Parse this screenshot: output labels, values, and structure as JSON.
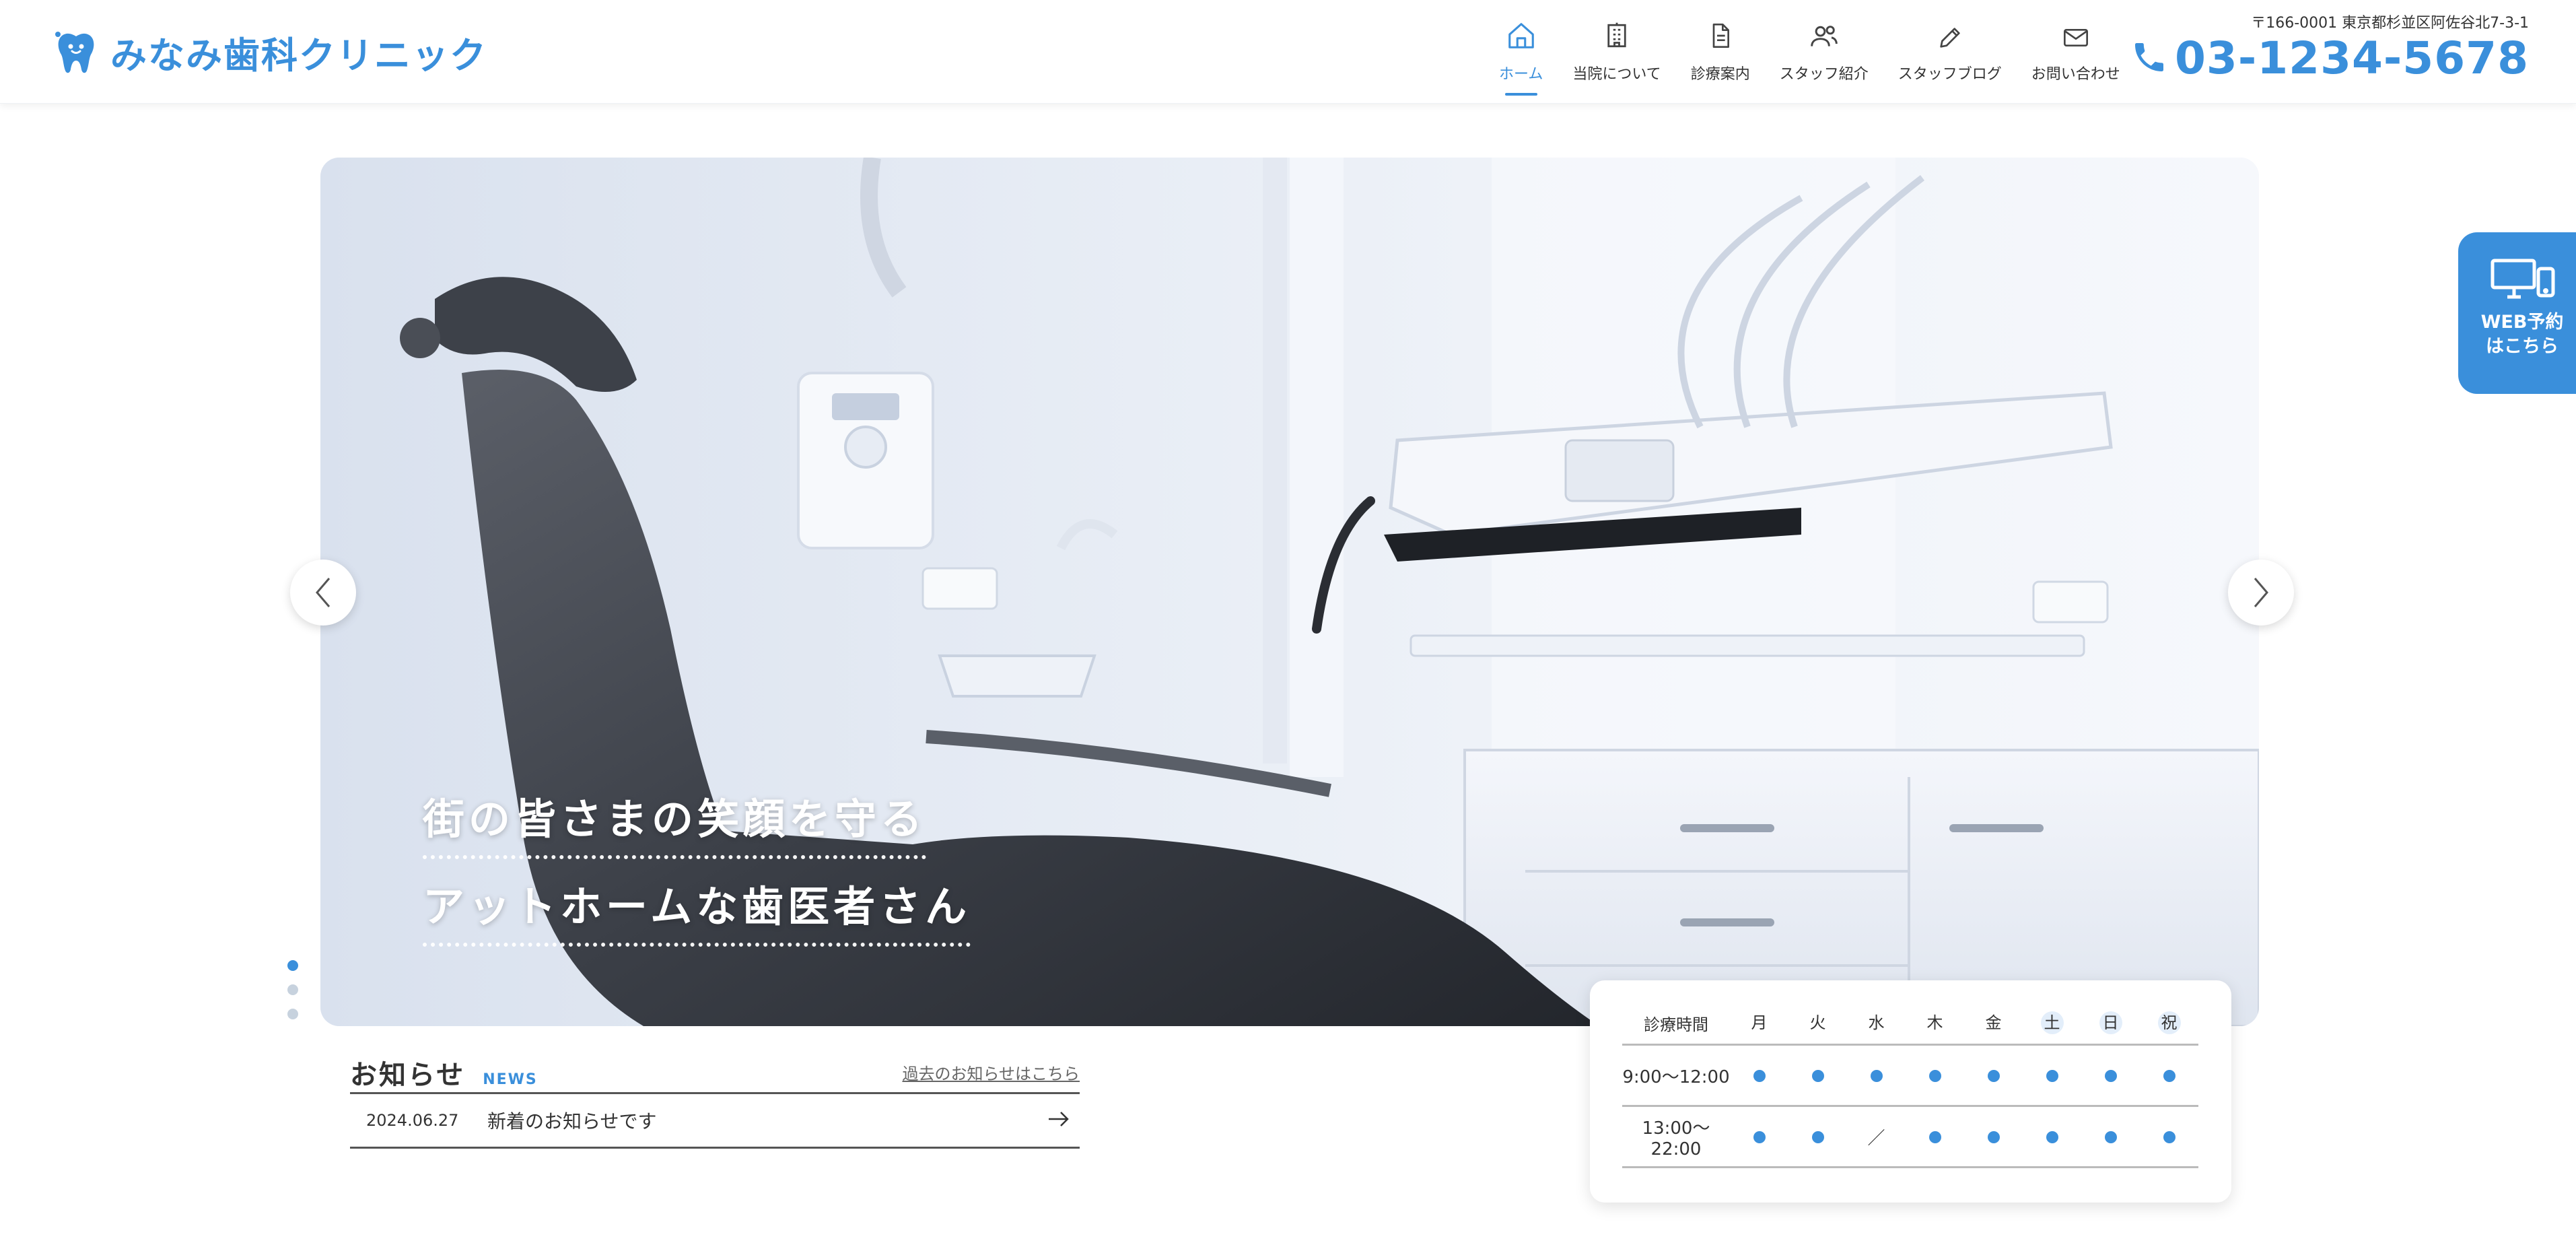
{
  "brand": {
    "name": "みなみ歯科クリニック",
    "accent": "#3a8fdb"
  },
  "nav": {
    "items": [
      {
        "label": "ホーム",
        "icon": "home-icon",
        "active": true
      },
      {
        "label": "当院について",
        "icon": "building-icon",
        "active": false
      },
      {
        "label": "診療案内",
        "icon": "document-icon",
        "active": false
      },
      {
        "label": "スタッフ紹介",
        "icon": "people-icon",
        "active": false
      },
      {
        "label": "スタッフブログ",
        "icon": "pencil-icon",
        "active": false
      },
      {
        "label": "お問い合わせ",
        "icon": "mail-icon",
        "active": false
      }
    ]
  },
  "contact": {
    "address": "〒166-0001 東京都杉並区阿佐谷北7-3-1",
    "phone": "03-1234-5678",
    "phone_icon": "phone-icon"
  },
  "hero": {
    "tagline_1": "街の皆さまの笑顔を守る",
    "tagline_2": "アットホームな歯医者さん",
    "slides_count": 3,
    "active_slide": 1
  },
  "web_reserve": {
    "line1": "WEB予約",
    "line2": "はこちら",
    "icon": "devices-icon"
  },
  "news": {
    "title": "お知らせ",
    "subtitle": "NEWS",
    "archive_link": "過去のお知らせはこちら",
    "items": [
      {
        "date": "2024.06.27",
        "text": "新着のお知らせです"
      }
    ]
  },
  "schedule": {
    "header_label": "診療時間",
    "days": [
      "月",
      "火",
      "水",
      "木",
      "金",
      "土",
      "日",
      "祝"
    ],
    "highlight_days": [
      "土",
      "日",
      "祝"
    ],
    "rows": [
      {
        "time": "9:00〜12:00",
        "marks": [
          "●",
          "●",
          "●",
          "●",
          "●",
          "●",
          "●",
          "●"
        ]
      },
      {
        "time": "13:00〜22:00",
        "marks": [
          "●",
          "●",
          "／",
          "●",
          "●",
          "●",
          "●",
          "●"
        ]
      }
    ]
  }
}
